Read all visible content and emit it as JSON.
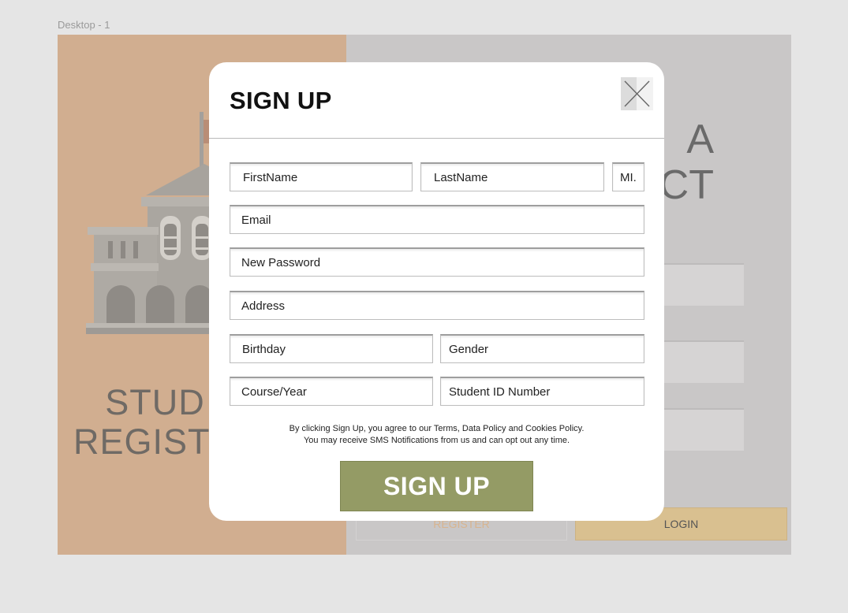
{
  "frame_label": "Desktop - 1",
  "background": {
    "title_line1": "STUD",
    "title_line2": "REGISTR",
    "heading_line1": "A",
    "heading_line2": "CT",
    "register_label": "REGISTER",
    "login_label": "LOGIN"
  },
  "modal": {
    "title": "SIGN UP",
    "close_icon": "close-icon",
    "fields": {
      "first_name": "FirstName",
      "last_name": "LastName",
      "middle_initial": "MI.",
      "email": "Email",
      "new_password": "New Password",
      "address": "Address",
      "birthday": "Birthday",
      "gender": "Gender",
      "course_year": "Course/Year",
      "student_id": "Student ID Number"
    },
    "terms_line1": "By clicking Sign Up, you agree to our Terms, Data Policy and Cookies Policy.",
    "terms_line2": "You may receive SMS Notifications from us and can opt out any time.",
    "submit_label": "SIGN UP"
  },
  "colors": {
    "left_panel": "#d1ae90",
    "right_panel": "#c9c7c7",
    "submit_button": "#949b65",
    "login_button": "#d9c090"
  }
}
